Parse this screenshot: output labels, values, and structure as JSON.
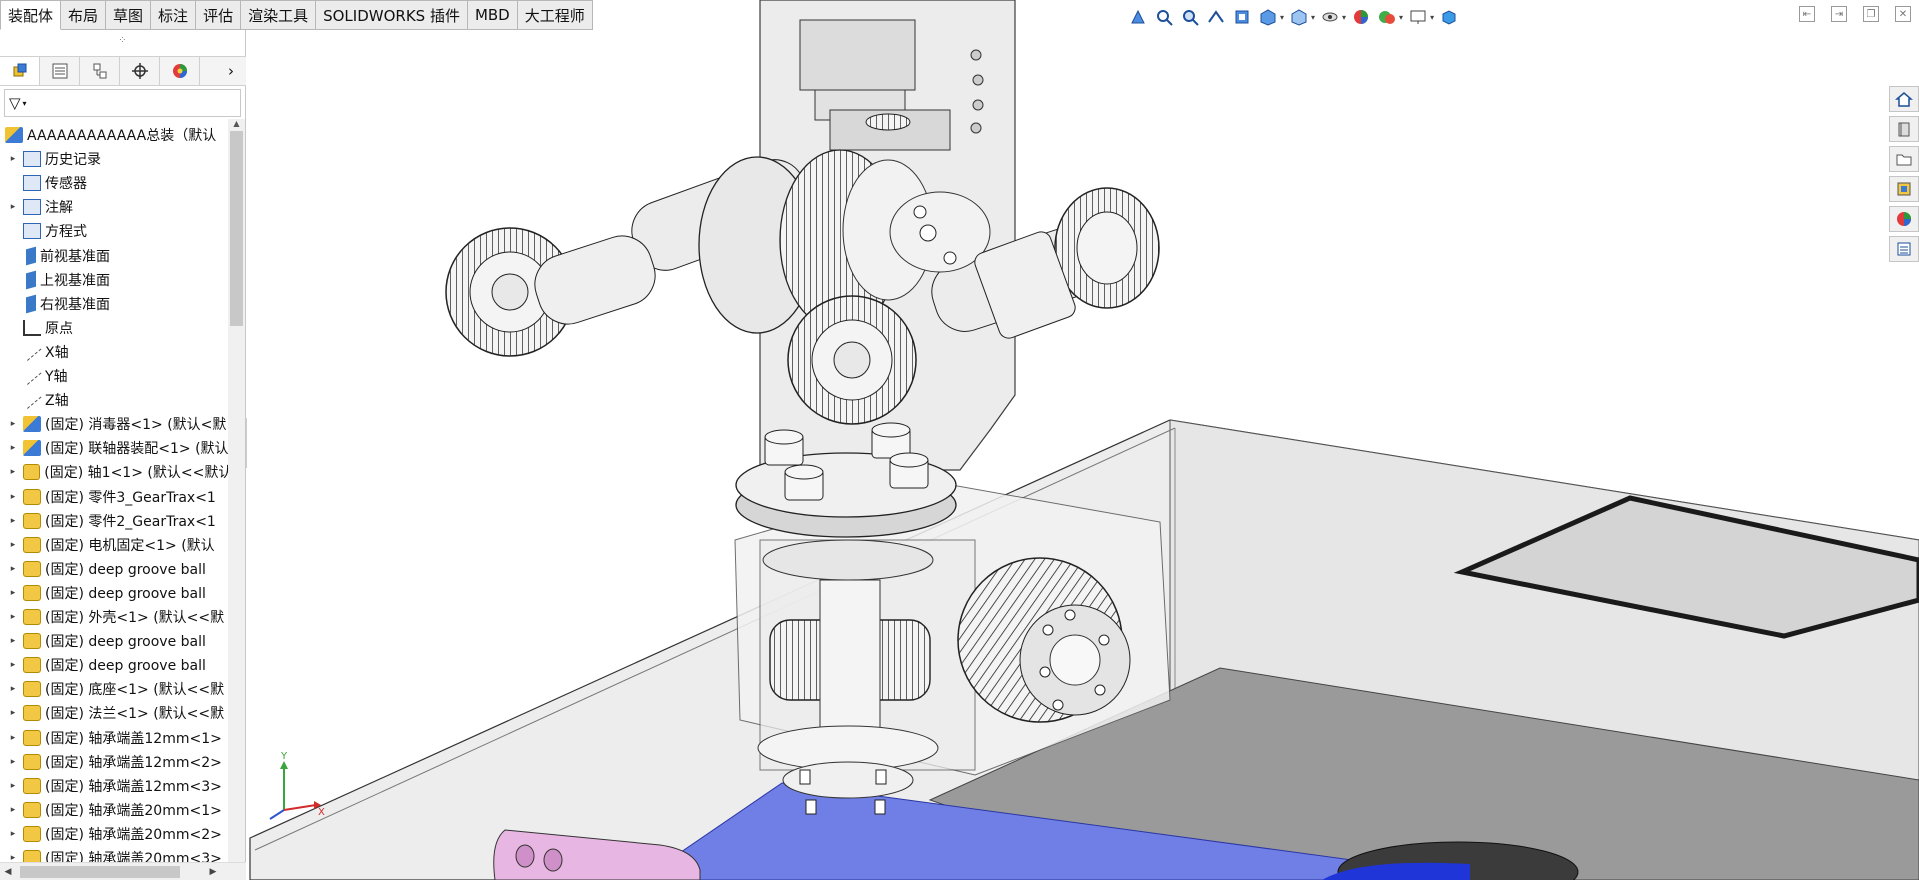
{
  "tabs": [
    {
      "label": "装配体",
      "active": true
    },
    {
      "label": "布局"
    },
    {
      "label": "草图"
    },
    {
      "label": "标注"
    },
    {
      "label": "评估"
    },
    {
      "label": "渲染工具"
    },
    {
      "label": "SOLIDWORKS 插件"
    },
    {
      "label": "MBD"
    },
    {
      "label": "大工程师"
    }
  ],
  "panel": {
    "tabs": [
      "feature-manager-icon",
      "property-manager-icon",
      "configuration-manager-icon",
      "dimxpert-icon",
      "display-manager-icon"
    ],
    "more_glyph": "›",
    "filter_glyph": "▽"
  },
  "tree": {
    "root": "AAAAAAAAAAAA总装（默认",
    "items": [
      {
        "label": "历史记录",
        "icon": "folder",
        "expand": true
      },
      {
        "label": "传感器",
        "icon": "sensor",
        "expand": false
      },
      {
        "label": "注解",
        "icon": "annotation",
        "expand": true
      },
      {
        "label": "方程式",
        "icon": "equation",
        "expand": false
      },
      {
        "label": "前视基准面",
        "icon": "plane",
        "expand": false
      },
      {
        "label": "上视基准面",
        "icon": "plane",
        "expand": false
      },
      {
        "label": "右视基准面",
        "icon": "plane",
        "expand": false
      },
      {
        "label": "原点",
        "icon": "origin",
        "expand": false
      },
      {
        "label": "X轴",
        "icon": "axis",
        "expand": false
      },
      {
        "label": "Y轴",
        "icon": "axis",
        "expand": false
      },
      {
        "label": "Z轴",
        "icon": "axis",
        "expand": false
      },
      {
        "label": "(固定) 消毒器<1> (默认<默",
        "icon": "asm",
        "expand": true
      },
      {
        "label": "(固定) 联轴器装配<1> (默认",
        "icon": "asm",
        "expand": true
      },
      {
        "label": "(固定) 轴1<1> (默认<<默认",
        "icon": "part",
        "expand": true
      },
      {
        "label": "(固定) 零件3_GearTrax<1",
        "icon": "part",
        "expand": true
      },
      {
        "label": "(固定) 零件2_GearTrax<1",
        "icon": "part",
        "expand": true
      },
      {
        "label": "(固定) 电机固定<1> (默认",
        "icon": "part",
        "expand": true
      },
      {
        "label": "(固定) deep groove ball",
        "icon": "part",
        "expand": true
      },
      {
        "label": "(固定) deep groove ball",
        "icon": "part",
        "expand": true
      },
      {
        "label": "(固定) 外壳<1> (默认<<默",
        "icon": "part",
        "expand": true
      },
      {
        "label": "(固定) deep groove ball",
        "icon": "part",
        "expand": true
      },
      {
        "label": "(固定) deep groove ball",
        "icon": "part",
        "expand": true
      },
      {
        "label": "(固定) 底座<1> (默认<<默",
        "icon": "part",
        "expand": true
      },
      {
        "label": "(固定) 法兰<1> (默认<<默",
        "icon": "part",
        "expand": true
      },
      {
        "label": "(固定) 轴承端盖12mm<1>",
        "icon": "part",
        "expand": true
      },
      {
        "label": "(固定) 轴承端盖12mm<2>",
        "icon": "part",
        "expand": true
      },
      {
        "label": "(固定) 轴承端盖12mm<3>",
        "icon": "part",
        "expand": true
      },
      {
        "label": "(固定) 轴承端盖20mm<1>",
        "icon": "part",
        "expand": true
      },
      {
        "label": "(固定) 轴承端盖20mm<2>",
        "icon": "part",
        "expand": true
      },
      {
        "label": "(固定) 轴承端盖20mm<3>",
        "icon": "part",
        "expand": true
      }
    ]
  },
  "hud": [
    "zoom-to-fit-icon",
    "zoom-area-icon",
    "previous-view-icon",
    "section-view-icon",
    "dynamic-annotation-icon",
    "view-orientation-icon",
    "display-style-icon",
    "hide-show-icon",
    "edit-appearance-icon",
    "apply-scene-icon",
    "view-settings-icon",
    "3d-view-icon"
  ],
  "taskpane": [
    "home-icon",
    "design-library-icon",
    "file-explorer-icon",
    "view-palette-icon",
    "appearances-icon",
    "custom-properties-icon"
  ],
  "triad": {
    "x": "X",
    "y": "Y"
  },
  "colors": {
    "accent": "#2f66b3",
    "base_plate": "#6f7fe6",
    "pink_part": "#e8b6e2",
    "gray_plate": "#9a9a9a"
  }
}
